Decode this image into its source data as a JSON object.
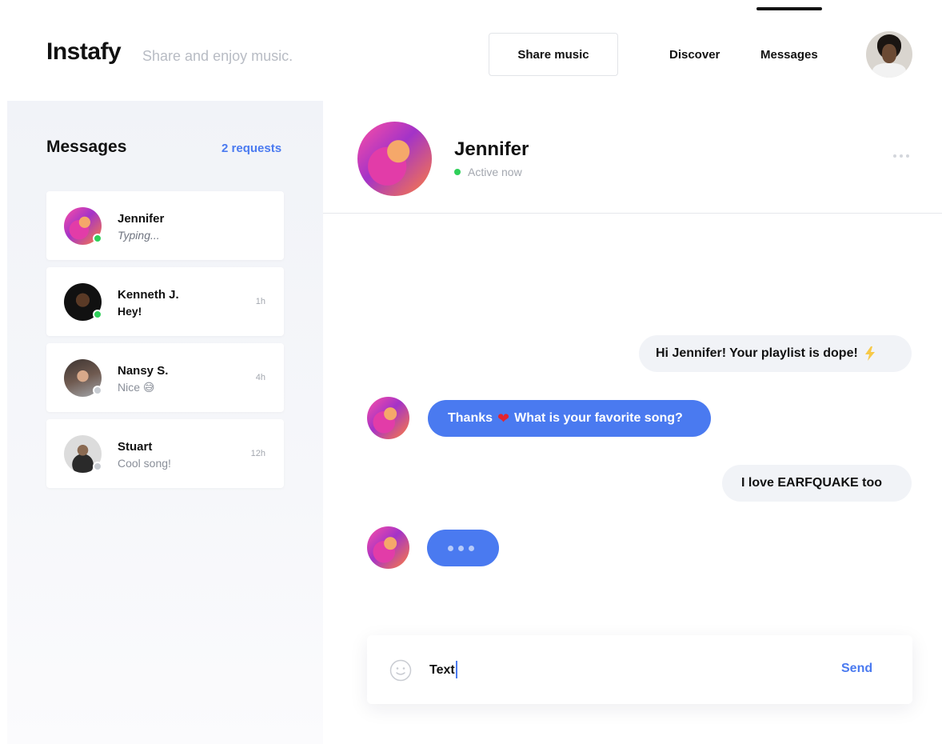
{
  "app": {
    "brand": "Instafy",
    "tagline": "Share and enjoy music."
  },
  "header": {
    "share_label": "Share music",
    "nav": [
      {
        "label": "Discover",
        "active": false
      },
      {
        "label": "Messages",
        "active": true
      }
    ],
    "user_avatar_icon": "user-avatar"
  },
  "sidebar": {
    "title": "Messages",
    "requests": "2 requests",
    "conversations": [
      {
        "name": "Jennifer",
        "preview": "Typing...",
        "time": "",
        "status": "online"
      },
      {
        "name": "Kenneth J.",
        "preview": "Hey!",
        "time": "1h",
        "status": "online"
      },
      {
        "name": "Nansy S.",
        "preview": "Nice 😅",
        "time": "4h",
        "status": "offline"
      },
      {
        "name": "Stuart",
        "preview": "Cool song!",
        "time": "12h",
        "status": "offline"
      }
    ]
  },
  "chat": {
    "name": "Jennifer",
    "status": "Active now",
    "more_icon": "more-horizontal-icon",
    "messages": [
      {
        "from": "me",
        "text": "Hi Jennifer! Your playlist is dope!",
        "icon": "lightning-icon"
      },
      {
        "from": "them",
        "text_before": "Thanks",
        "icon": "heart-icon",
        "text_after": "What is your favorite song?"
      },
      {
        "from": "me",
        "text": "I love EARFQUAKE too"
      },
      {
        "from": "them",
        "typing": true
      }
    ]
  },
  "composer": {
    "value": "Text",
    "send_label": "Send",
    "emoji_icon": "emoji-icon"
  },
  "colors": {
    "accent": "#4a7af0",
    "online": "#2fd05a",
    "offline": "#c8ccd2",
    "sidebar_bg": "#f1f3f8",
    "bubble_out": "#f1f3f7"
  }
}
